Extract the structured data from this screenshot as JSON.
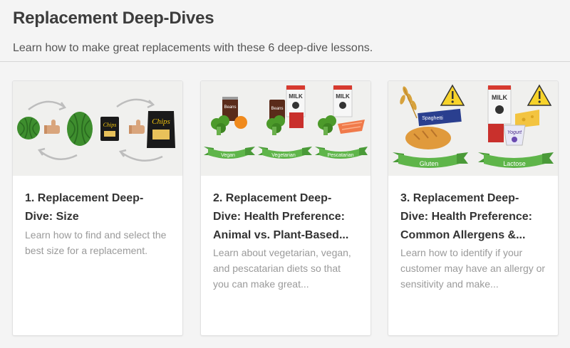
{
  "page": {
    "title": "Replacement Deep-Dives",
    "subtitle": "Learn how to make great replacements with these 6 deep-dive lessons."
  },
  "cards": [
    {
      "title": "1. Replacement Deep-Dive: Size",
      "description": "Learn how to find and select the best size for a replacement.",
      "illustration": {
        "icons": [
          "watermelon-icon",
          "thumbs-up-icon",
          "chips-bag-icon",
          "cycle-arrows-icon"
        ],
        "chips_label": "Chips"
      }
    },
    {
      "title": "2. Replacement Deep-Dive: Health Preference: Animal vs. Plant-Based...",
      "description": "Learn about vegetarian, vegan, and pescatarian diets so that you can make great...",
      "illustration": {
        "labels": [
          "Vegan",
          "Vegetarian",
          "Pescatarian"
        ],
        "can_label": "Beans",
        "milk_label": "MILK"
      }
    },
    {
      "title": "3. Replacement Deep-Dive: Health Preference: Common Allergens &...",
      "description": "Learn how to identify if your customer may have an allergy or sensitivity and make...",
      "illustration": {
        "labels": [
          "Gluten",
          "Lactose"
        ],
        "pasta_label": "Spaghetti",
        "milk_label": "MILK",
        "yogurt_label": "Yogurt"
      }
    }
  ],
  "colors": {
    "green_banner": "#5fb54a",
    "warning_yellow": "#f7d32a",
    "watermelon_green": "#3e8e2e",
    "milk_red": "#d63a2f"
  }
}
